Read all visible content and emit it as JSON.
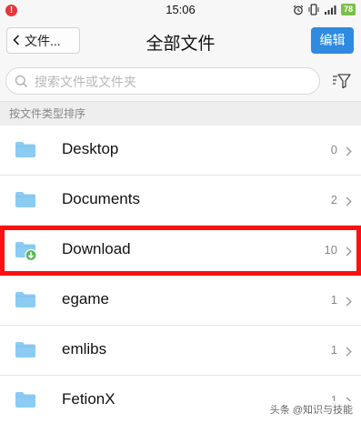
{
  "status_bar": {
    "time": "15:06",
    "notification_badge": "!",
    "battery": "78",
    "icons": [
      "alarm-icon",
      "vibrate-icon",
      "signal-icon"
    ]
  },
  "nav": {
    "back_label": "文件...",
    "title": "全部文件",
    "edit_label": "编辑"
  },
  "search": {
    "placeholder": "搜索文件或文件夹",
    "value": ""
  },
  "section_label": "按文件类型排序",
  "files": [
    {
      "name": "Desktop",
      "count": "0",
      "icon": "folder-icon"
    },
    {
      "name": "Documents",
      "count": "2",
      "icon": "folder-icon"
    },
    {
      "name": "Download",
      "count": "10",
      "icon": "folder-download-icon"
    },
    {
      "name": "egame",
      "count": "1",
      "icon": "folder-icon"
    },
    {
      "name": "emlibs",
      "count": "1",
      "icon": "folder-icon"
    },
    {
      "name": "FetionX",
      "count": "1",
      "icon": "folder-icon"
    }
  ],
  "watermark": "头条 @知识与技能",
  "colors": {
    "accent": "#2f8ae0",
    "folder": "#8ccbf2",
    "highlight": "#ff1010",
    "download_badge": "#5cb85c"
  }
}
